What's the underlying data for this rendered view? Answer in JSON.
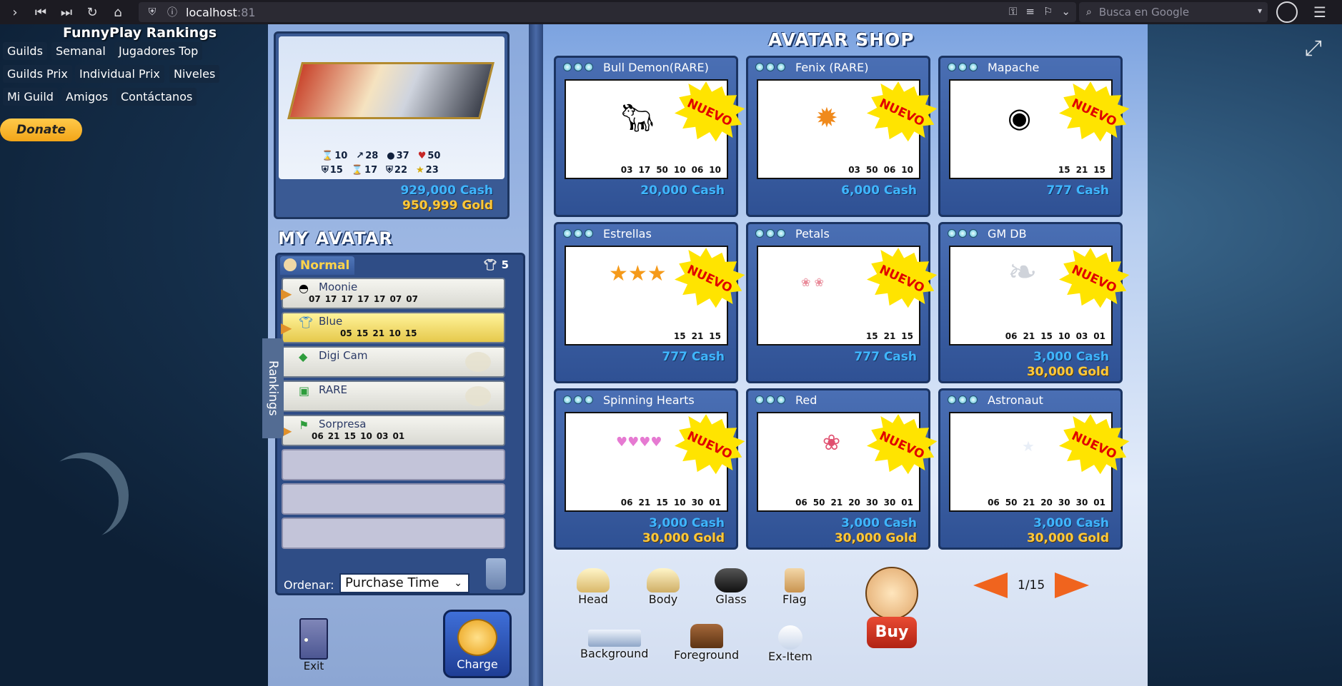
{
  "browser": {
    "url_host": "localhost",
    "url_port": ":81",
    "search_placeholder": "Busca en Google"
  },
  "sidebar": {
    "title": "FunnyPlay Rankings",
    "links": [
      "Guilds",
      "Semanal",
      "Jugadores Top",
      "Guilds Prix",
      "Individual Prix",
      "Niveles",
      "Mi Guild",
      "Amigos",
      "Contáctanos"
    ],
    "donate_label": "Donate"
  },
  "preview": {
    "stats_row1": [
      {
        "icon": "hourglass-icon",
        "value": "10"
      },
      {
        "icon": "arrow-icon",
        "value": "28"
      },
      {
        "icon": "bomb-icon",
        "value": "37"
      },
      {
        "icon": "heart-icon",
        "value": "50"
      }
    ],
    "stats_row2": [
      {
        "icon": "shield-icon",
        "value": "15"
      },
      {
        "icon": "hourglass-icon",
        "value": "17"
      },
      {
        "icon": "shield-icon",
        "value": "22"
      },
      {
        "icon": "star-icon",
        "value": "23"
      }
    ],
    "cash": "929,000 Cash",
    "gold": "950,999 Gold"
  },
  "my_avatar": {
    "title": "MY AVATAR",
    "tab_label": "Normal",
    "slot_count": "5",
    "items": [
      {
        "name": "Moonie",
        "stats": [
          "07",
          "17",
          "17",
          "17",
          "17",
          "07",
          "07"
        ],
        "selected": false
      },
      {
        "name": "Blue",
        "stats": [
          "05",
          "15",
          "21",
          "10",
          "15"
        ],
        "selected": true
      },
      {
        "name": "Digi Cam",
        "stats": [],
        "selected": false
      },
      {
        "name": "RARE",
        "stats": [],
        "selected": false
      },
      {
        "name": "Sorpresa",
        "stats": [
          "06",
          "21",
          "15",
          "10",
          "03",
          "01"
        ],
        "selected": false
      }
    ],
    "rankings_tab": "Rankings",
    "sort_label": "Ordenar:",
    "sort_value": "Purchase Time",
    "exit_label": "Exit",
    "charge_label": "Charge"
  },
  "shop": {
    "title": "AVATAR SHOP",
    "nuevo_label": "NUEVO",
    "items": [
      {
        "name": "Bull Demon(RARE)",
        "stats": [
          "03",
          "17",
          "50",
          "10",
          "06",
          "10"
        ],
        "cash": "20,000 Cash",
        "gold": ""
      },
      {
        "name": "Fenix (RARE)",
        "stats": [
          "03",
          "50",
          "06",
          "10"
        ],
        "cash": "6,000 Cash",
        "gold": ""
      },
      {
        "name": "Mapache",
        "stats": [
          "15",
          "21",
          "15"
        ],
        "cash": "777 Cash",
        "gold": ""
      },
      {
        "name": "Estrellas",
        "stats": [
          "15",
          "21",
          "15"
        ],
        "cash": "777 Cash",
        "gold": ""
      },
      {
        "name": "Petals",
        "stats": [
          "15",
          "21",
          "15"
        ],
        "cash": "777 Cash",
        "gold": ""
      },
      {
        "name": "GM DB",
        "stats": [
          "06",
          "21",
          "15",
          "10",
          "03",
          "01"
        ],
        "cash": "3,000 Cash",
        "gold": "30,000 Gold"
      },
      {
        "name": "Spinning Hearts",
        "stats": [
          "06",
          "21",
          "15",
          "10",
          "30",
          "01"
        ],
        "cash": "3,000 Cash",
        "gold": "30,000 Gold"
      },
      {
        "name": "Red",
        "stats": [
          "06",
          "50",
          "21",
          "20",
          "30",
          "30",
          "01"
        ],
        "cash": "3,000 Cash",
        "gold": "30,000 Gold"
      },
      {
        "name": "Astronaut",
        "stats": [
          "06",
          "50",
          "21",
          "20",
          "30",
          "30",
          "01"
        ],
        "cash": "3,000 Cash",
        "gold": "30,000 Gold"
      }
    ],
    "categories": [
      "Head",
      "Body",
      "Glass",
      "Flag",
      "Background",
      "Foreground",
      "Ex-Item"
    ],
    "buy_label": "Buy",
    "page_indicator": "1/15"
  }
}
